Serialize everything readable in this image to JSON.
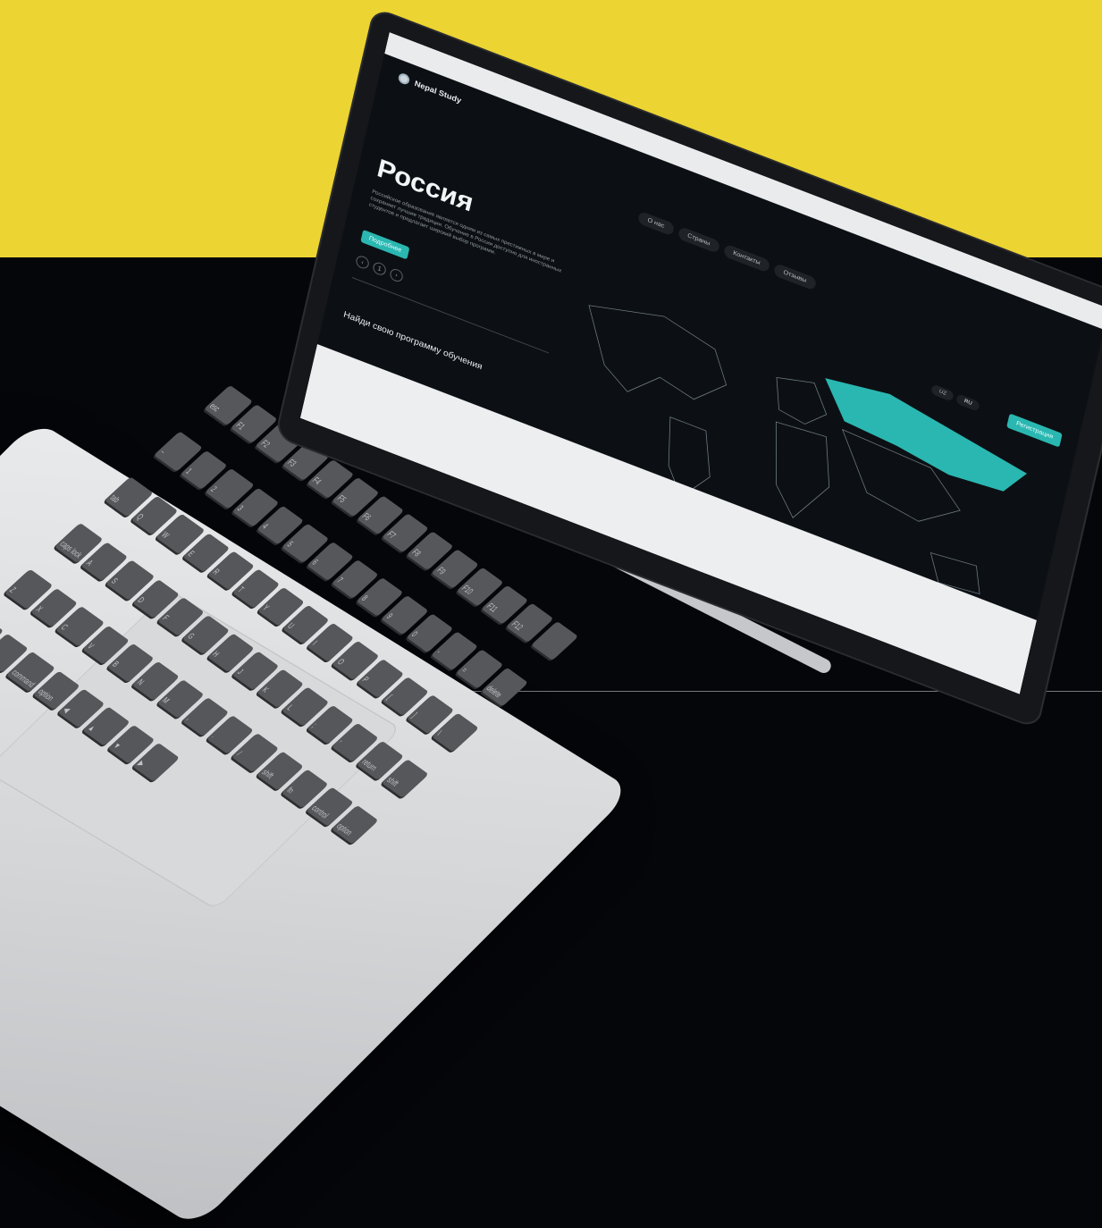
{
  "page": {
    "brand": "Nepal Study",
    "nav": [
      "О нас",
      "Страны",
      "Контакты",
      "Отзывы"
    ],
    "hero": {
      "title": "Россия",
      "text": "Российское образование является одним из самых престижных в мире и сохраняет лучшие традиции. Обучение в России доступно для иностранных студентов и предлагает широкий выбор программ.",
      "button": "Подробнее",
      "slider_prev": "‹",
      "slider_page": "1",
      "slider_next": "›"
    },
    "section_title": "Найди свою программу обучения",
    "language": {
      "options": [
        "UZ",
        "RU"
      ],
      "selected": "RU"
    },
    "register_button": "Регистрация",
    "accent": "#2ab7b1"
  },
  "keyboard": {
    "keys": [
      "esc",
      "F1",
      "F2",
      "F3",
      "F4",
      "F5",
      "F6",
      "F7",
      "F8",
      "F9",
      "F10",
      "F11",
      "F12",
      "",
      "~",
      "1",
      "2",
      "3",
      "4",
      "5",
      "6",
      "7",
      "8",
      "9",
      "0",
      "-",
      "=",
      "delete",
      "tab",
      "Q",
      "W",
      "E",
      "R",
      "T",
      "Y",
      "U",
      "I",
      "O",
      "P",
      "[",
      "]",
      "\\",
      "caps lock",
      "A",
      "S",
      "D",
      "F",
      "G",
      "H",
      "J",
      "K",
      "L",
      ";",
      "'",
      "return",
      "shift",
      "Z",
      "X",
      "C",
      "V",
      "B",
      "N",
      "M",
      ",",
      ".",
      "/",
      "shift",
      "fn",
      "control",
      "option",
      "command",
      "",
      "command",
      "option",
      "◀",
      "▲",
      "▼",
      "▶"
    ]
  }
}
